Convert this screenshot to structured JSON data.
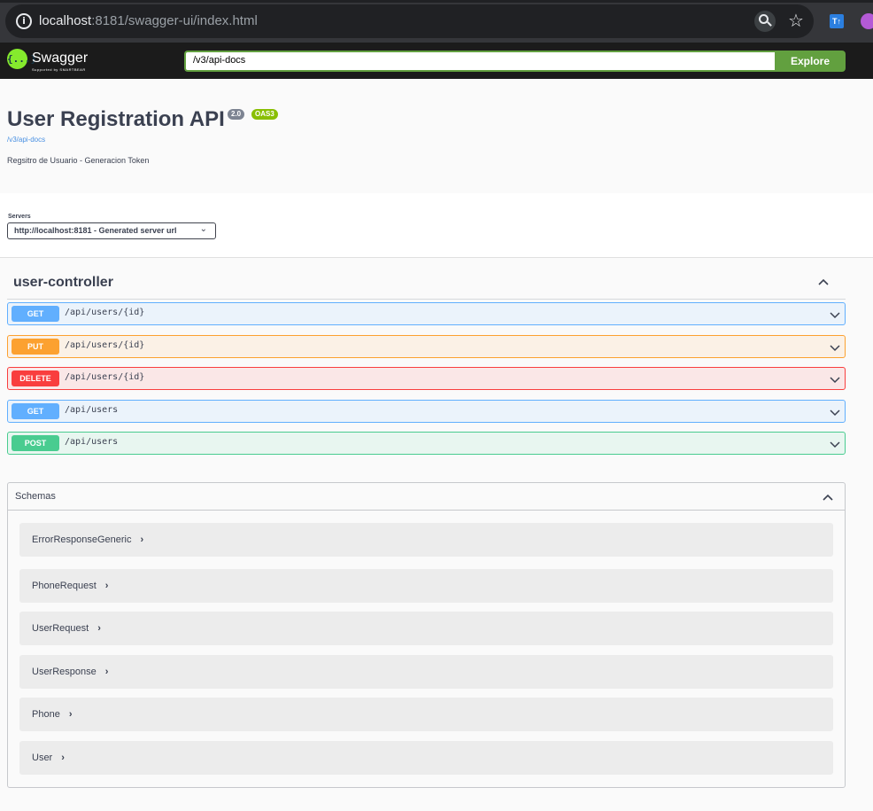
{
  "browser": {
    "url_host": "localhost",
    "url_rest": ":8181/swagger-ui/index.html",
    "extension_badge": "T↑"
  },
  "topbar": {
    "logo_text": "Swagger",
    "logo_sub": "Supported by SMARTBEAR",
    "logo_glyph": "{...}",
    "spec_url": "/v3/api-docs",
    "explore_label": "Explore"
  },
  "info": {
    "title": "User Registration API",
    "version": "2.0",
    "oas": "OAS3",
    "spec_link": "/v3/api-docs",
    "description": "Regsitro de Usuario - Generacion Token"
  },
  "servers": {
    "label": "Servers",
    "selected": "http://localhost:8181 - Generated server url"
  },
  "controller": {
    "name": "user-controller",
    "operations": [
      {
        "method": "GET",
        "path": "/api/users/{id}"
      },
      {
        "method": "PUT",
        "path": "/api/users/{id}"
      },
      {
        "method": "DELETE",
        "path": "/api/users/{id}"
      },
      {
        "method": "GET",
        "path": "/api/users"
      },
      {
        "method": "POST",
        "path": "/api/users"
      }
    ]
  },
  "schemas": {
    "title": "Schemas",
    "models": [
      {
        "name": "ErrorResponseGeneric"
      },
      {
        "name": "PhoneRequest"
      },
      {
        "name": "UserRequest"
      },
      {
        "name": "UserResponse"
      },
      {
        "name": "Phone"
      },
      {
        "name": "User"
      }
    ]
  },
  "colors": {
    "get": "#61affe",
    "put": "#fca130",
    "delete": "#f93e3e",
    "post": "#49cc90",
    "swagger_green": "#85ea2d",
    "explore": "#62a03f"
  }
}
